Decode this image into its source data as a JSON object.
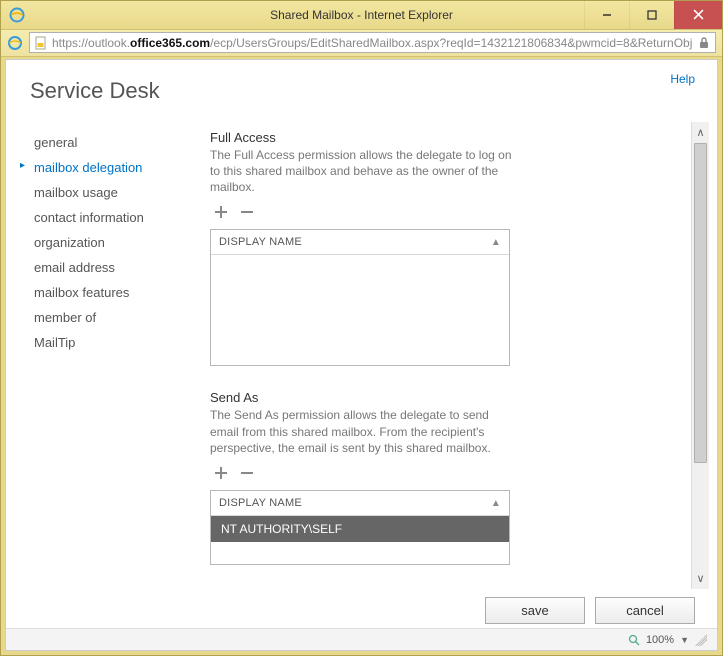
{
  "window": {
    "title": "Shared Mailbox - Internet Explorer"
  },
  "address": {
    "prefix": "https://outlook.",
    "domain": "office365.com",
    "path": "/ecp/UsersGroups/EditSharedMailbox.aspx?reqId=1432121806834&pwmcid=8&ReturnObjectTyp"
  },
  "help_label": "Help",
  "page_title": "Service Desk",
  "nav": {
    "items": [
      {
        "label": "general"
      },
      {
        "label": "mailbox delegation",
        "active": true
      },
      {
        "label": "mailbox usage"
      },
      {
        "label": "contact information"
      },
      {
        "label": "organization"
      },
      {
        "label": "email address"
      },
      {
        "label": "mailbox features"
      },
      {
        "label": "member of"
      },
      {
        "label": "MailTip"
      }
    ]
  },
  "sections": {
    "full_access": {
      "title": "Full Access",
      "desc": "The Full Access permission allows the delegate to log on to this shared mailbox and behave as the owner of the mailbox.",
      "column": "DISPLAY NAME",
      "rows": []
    },
    "send_as": {
      "title": "Send As",
      "desc": "The Send As permission allows the delegate to send email from this shared mailbox. From the recipient's perspective, the email is sent by this shared mailbox.",
      "column": "DISPLAY NAME",
      "rows": [
        {
          "label": "NT AUTHORITY\\SELF",
          "selected": true
        }
      ]
    }
  },
  "buttons": {
    "save": "save",
    "cancel": "cancel"
  },
  "status": {
    "zoom": "100%"
  }
}
